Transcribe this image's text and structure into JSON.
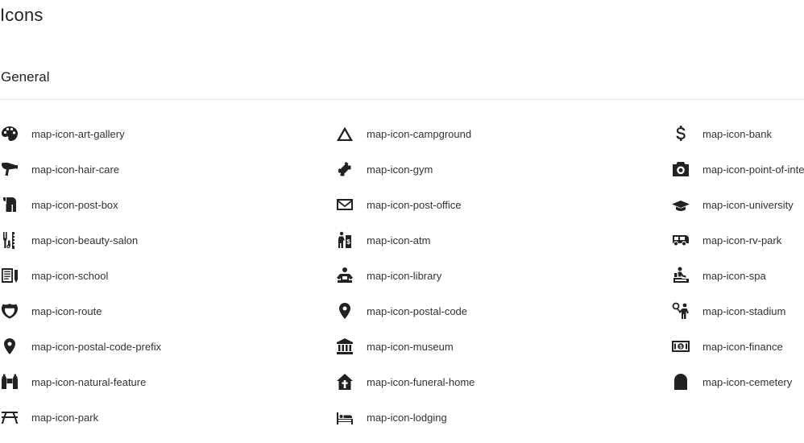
{
  "page": {
    "title": "Icons",
    "section": "General"
  },
  "columns": [
    [
      {
        "icon": "art-gallery-icon",
        "label": "map-icon-art-gallery"
      },
      {
        "icon": "hair-care-icon",
        "label": "map-icon-hair-care"
      },
      {
        "icon": "post-box-icon",
        "label": "map-icon-post-box"
      },
      {
        "icon": "beauty-salon-icon",
        "label": "map-icon-beauty-salon"
      },
      {
        "icon": "school-icon",
        "label": "map-icon-school"
      },
      {
        "icon": "route-icon",
        "label": "map-icon-route"
      },
      {
        "icon": "postal-code-prefix-icon",
        "label": "map-icon-postal-code-prefix"
      },
      {
        "icon": "natural-feature-icon",
        "label": "map-icon-natural-feature"
      },
      {
        "icon": "park-icon",
        "label": "map-icon-park"
      }
    ],
    [
      {
        "icon": "campground-icon",
        "label": "map-icon-campground"
      },
      {
        "icon": "gym-icon",
        "label": "map-icon-gym"
      },
      {
        "icon": "post-office-icon",
        "label": "map-icon-post-office"
      },
      {
        "icon": "atm-icon",
        "label": "map-icon-atm"
      },
      {
        "icon": "library-icon",
        "label": "map-icon-library"
      },
      {
        "icon": "postal-code-icon",
        "label": "map-icon-postal-code"
      },
      {
        "icon": "museum-icon",
        "label": "map-icon-museum"
      },
      {
        "icon": "funeral-home-icon",
        "label": "map-icon-funeral-home"
      },
      {
        "icon": "lodging-icon",
        "label": "map-icon-lodging"
      }
    ],
    [
      {
        "icon": "bank-icon",
        "label": "map-icon-bank"
      },
      {
        "icon": "point-of-interest-icon",
        "label": "map-icon-point-of-interest"
      },
      {
        "icon": "university-icon",
        "label": "map-icon-university"
      },
      {
        "icon": "rv-park-icon",
        "label": "map-icon-rv-park"
      },
      {
        "icon": "spa-icon",
        "label": "map-icon-spa"
      },
      {
        "icon": "stadium-icon",
        "label": "map-icon-stadium"
      },
      {
        "icon": "finance-icon",
        "label": "map-icon-finance"
      },
      {
        "icon": "cemetery-icon",
        "label": "map-icon-cemetery"
      }
    ]
  ]
}
